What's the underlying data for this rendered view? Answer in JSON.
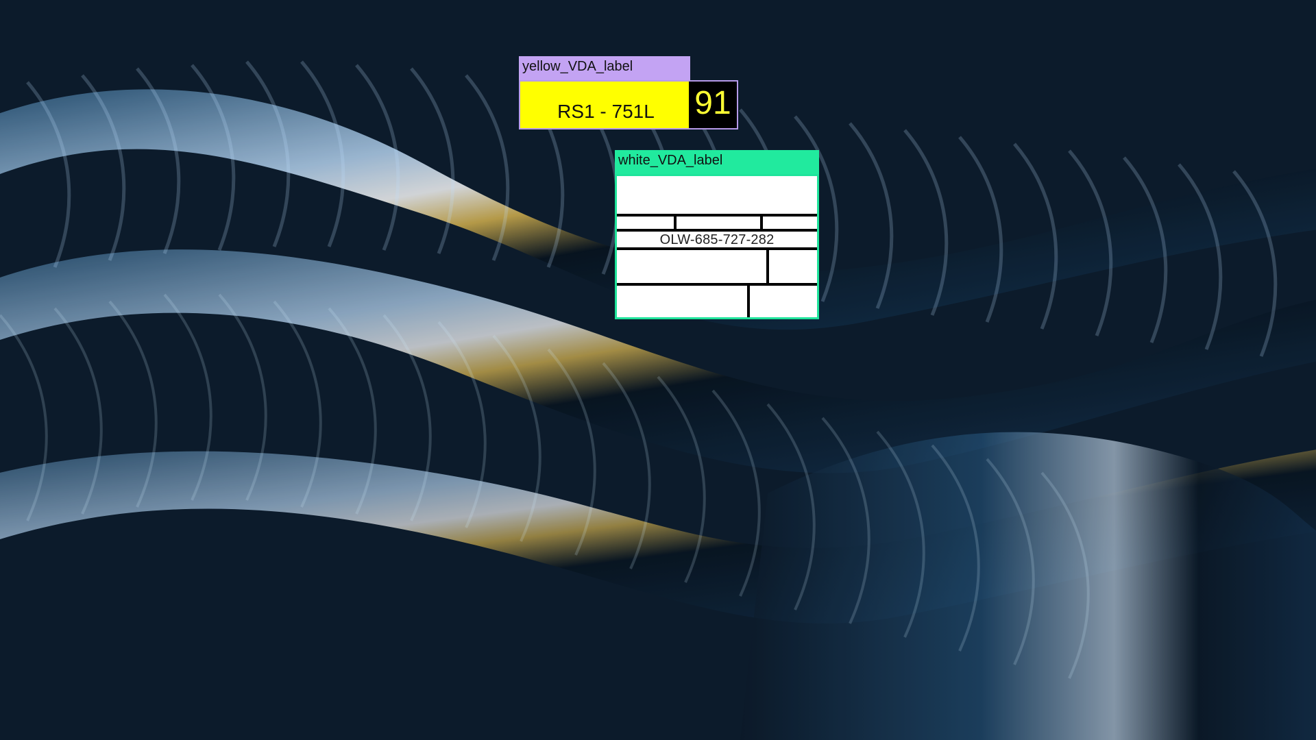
{
  "scene": {
    "background": "dark metallic blue ribbed surface"
  },
  "yellow_label": {
    "tag": "yellow_VDA_label",
    "code": "RS1 - 751L",
    "number": "91",
    "colors": {
      "tag": "#c3a3f3",
      "body": "#ffff00",
      "number_background": "#000000",
      "number_text": "#ffff33"
    }
  },
  "white_label": {
    "tag": "white_VDA_label",
    "code": "OLW-685-727-282",
    "colors": {
      "tag": "#21ea9e",
      "body": "#ffffff",
      "border": "#1fe49b",
      "lines": "#000000"
    }
  }
}
